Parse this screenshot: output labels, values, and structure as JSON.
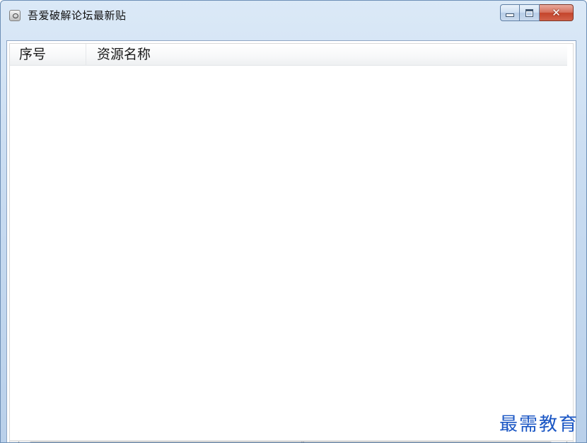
{
  "window": {
    "title": "吾爱破解论坛最新贴",
    "icon": "magnifier-app-icon",
    "controls": {
      "minimize_icon": "minimize-icon",
      "maximize_icon": "maximize-icon",
      "close_label": "✕"
    }
  },
  "listview": {
    "columns": [
      {
        "label": "序号"
      },
      {
        "label": "资源名称"
      }
    ],
    "rows": [],
    "scrollbar": {
      "left_arrow": "‹",
      "grip": "|||",
      "right_arrow": "›"
    }
  },
  "watermark": {
    "text": "最需教育"
  },
  "colors": {
    "titlebar": "#c9dcf1",
    "close_button": "#c4442b",
    "watermark": "#1a56c4"
  }
}
